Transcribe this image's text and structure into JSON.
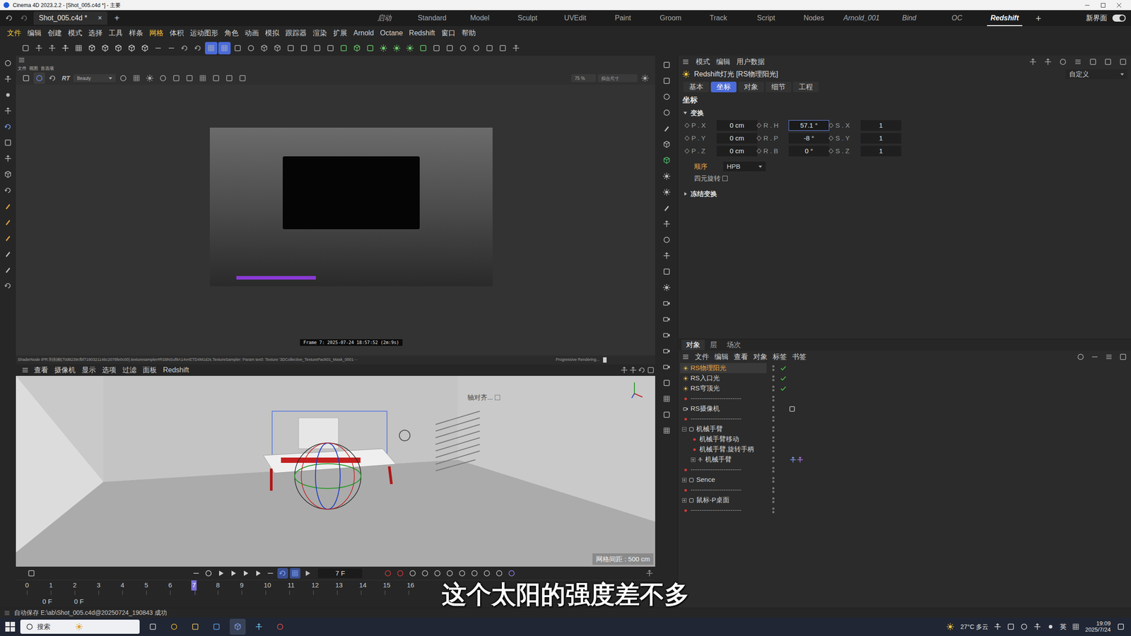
{
  "window": {
    "title": "Cinema 4D 2023.2.2 - [Shot_005.c4d *] - 主要"
  },
  "document_tab": {
    "label": "Shot_005.c4d *",
    "close": "×",
    "add": "+"
  },
  "layouts": [
    {
      "label": "启动",
      "selected": false,
      "italic": true
    },
    {
      "label": "Standard",
      "selected": false,
      "italic": false
    },
    {
      "label": "Model",
      "selected": false,
      "italic": false
    },
    {
      "label": "Sculpt",
      "selected": false,
      "italic": false
    },
    {
      "label": "UVEdit",
      "selected": false,
      "italic": false
    },
    {
      "label": "Paint",
      "selected": false,
      "italic": false
    },
    {
      "label": "Groom",
      "selected": false,
      "italic": false
    },
    {
      "label": "Track",
      "selected": false,
      "italic": false
    },
    {
      "label": "Script",
      "selected": false,
      "italic": false
    },
    {
      "label": "Nodes",
      "selected": false,
      "italic": false
    },
    {
      "label": "Arnold_001",
      "selected": false,
      "italic": true
    },
    {
      "label": "Bind",
      "selected": false,
      "italic": true
    },
    {
      "label": "OC",
      "selected": false,
      "italic": true
    },
    {
      "label": "Redshift",
      "selected": true,
      "italic": true
    }
  ],
  "layout_add": "+",
  "new_ui": {
    "label": "新界面",
    "on": true
  },
  "menu": [
    {
      "label": "文件",
      "highlight": true
    },
    {
      "label": "编辑",
      "highlight": false
    },
    {
      "label": "创建",
      "highlight": false
    },
    {
      "label": "模式",
      "highlight": false
    },
    {
      "label": "选择",
      "highlight": false
    },
    {
      "label": "工具",
      "highlight": false
    },
    {
      "label": "样条",
      "highlight": false
    },
    {
      "label": "网格",
      "highlight": true
    },
    {
      "label": "体积",
      "highlight": false
    },
    {
      "label": "运动图形",
      "highlight": false
    },
    {
      "label": "角色",
      "highlight": false
    },
    {
      "label": "动画",
      "highlight": false
    },
    {
      "label": "模拟",
      "highlight": false
    },
    {
      "label": "跟踪器",
      "highlight": false
    },
    {
      "label": "渲染",
      "highlight": false
    },
    {
      "label": "扩展",
      "highlight": false
    },
    {
      "label": "Arnold",
      "highlight": false
    },
    {
      "label": "Octane",
      "highlight": false
    },
    {
      "label": "Redshift",
      "highlight": false
    },
    {
      "label": "窗口",
      "highlight": false
    },
    {
      "label": "帮助",
      "highlight": false
    }
  ],
  "render_view": {
    "menu": [
      "文件",
      "视图",
      "首选项"
    ],
    "rt": "RT",
    "pass": "Beauty",
    "zoom": "75 %",
    "fit": "拟合尺寸",
    "caption": "Frame 7: 2025-07-24 18:57:52 (2m:9s)",
    "status_left": "ShaderNode IPR:到别称(70d8239cfbf7190321146c2078fe0c00).texturesampler#RS8NSuf8A14vnETD4M1dJs.TextureSampler: Param tex0: Texture '3DCollective_TexturePack01_Mask_0001···",
    "status_right": "Progressive Rendering..."
  },
  "viewport": {
    "menu": [
      "查看",
      "摄像机",
      "显示",
      "选项",
      "过滤",
      "面板",
      "Redshift"
    ],
    "axis_label": "轴对齐...",
    "grid": "网格间距 : 500 cm"
  },
  "timeline": {
    "frame": "7 F",
    "ticks": [
      {
        "label": "0",
        "selected": false
      },
      {
        "label": "1",
        "selected": false
      },
      {
        "label": "2",
        "selected": false
      },
      {
        "label": "3",
        "selected": false
      },
      {
        "label": "4",
        "selected": false
      },
      {
        "label": "5",
        "selected": false
      },
      {
        "label": "6",
        "selected": false
      },
      {
        "label": "7",
        "selected": true
      },
      {
        "label": "8",
        "selected": false
      },
      {
        "label": "9",
        "selected": false
      },
      {
        "label": "10",
        "selected": false
      },
      {
        "label": "11",
        "selected": false
      },
      {
        "label": "12",
        "selected": false
      },
      {
        "label": "13",
        "selected": false
      },
      {
        "label": "14",
        "selected": false
      },
      {
        "label": "15",
        "selected": false
      },
      {
        "label": "16",
        "selected": false
      }
    ],
    "start": "0 F",
    "end": "0 F"
  },
  "attributes": {
    "menu": [
      "模式",
      "编辑",
      "用户数据"
    ],
    "title": "Redshift灯光 [RS物理阳光]",
    "preset": "自定义",
    "tabs": [
      {
        "label": "基本",
        "selected": false
      },
      {
        "label": "坐标",
        "selected": true
      },
      {
        "label": "对象",
        "selected": false
      },
      {
        "label": "细节",
        "selected": false
      },
      {
        "label": "工程",
        "selected": false
      }
    ],
    "section": "坐标",
    "group": "变换",
    "fields": [
      [
        {
          "label": "P . X",
          "value": "0 cm",
          "focused": false
        },
        {
          "label": "R . H",
          "value": "57.1 °",
          "focused": true
        },
        {
          "label": "S . X",
          "value": "1",
          "focused": false
        }
      ],
      [
        {
          "label": "P . Y",
          "value": "0 cm",
          "focused": false
        },
        {
          "label": "R . P",
          "value": "-8 °",
          "focused": false
        },
        {
          "label": "S . Y",
          "value": "1",
          "focused": false
        }
      ],
      [
        {
          "label": "P . Z",
          "value": "0 cm",
          "focused": false
        },
        {
          "label": "R . B",
          "value": "0 °",
          "focused": false
        },
        {
          "label": "S . Z",
          "value": "1",
          "focused": false
        }
      ]
    ],
    "order_label": "顺序",
    "order_value": "HPB",
    "quat_label": "四元旋转",
    "quat_checked": false,
    "freeze": "冻结变换"
  },
  "objects": {
    "tabs": [
      {
        "label": "对象",
        "selected": true
      },
      {
        "label": "层",
        "selected": false
      },
      {
        "label": "场次",
        "selected": false
      }
    ],
    "menu": [
      "文件",
      "编辑",
      "查看",
      "对象",
      "标签",
      "书签"
    ],
    "items": [
      {
        "name": "RS物理阳光",
        "kind": "light",
        "depth": 0,
        "selected": true,
        "checked": true
      },
      {
        "name": "RS入口光",
        "kind": "light",
        "depth": 0,
        "selected": false,
        "checked": true
      },
      {
        "name": "RS穹顶光",
        "kind": "light",
        "depth": 0,
        "selected": false,
        "checked": true
      },
      {
        "name": "-----------------------",
        "kind": "separator",
        "depth": 0,
        "selected": false,
        "checked": false
      },
      {
        "name": "RS摄像机",
        "kind": "camera",
        "depth": 0,
        "selected": false,
        "checked": false
      },
      {
        "name": "-----------------------",
        "kind": "separator",
        "depth": 0,
        "selected": false,
        "checked": false
      },
      {
        "name": "机械手臂",
        "kind": "group",
        "depth": 0,
        "selected": false,
        "checked": false,
        "expanded": true
      },
      {
        "name": "机械手臂移动",
        "kind": "point",
        "depth": 1,
        "selected": false,
        "checked": false
      },
      {
        "name": "机械手臂.旋转手柄",
        "kind": "point",
        "depth": 1,
        "selected": false,
        "checked": false
      },
      {
        "name": "机械手臂",
        "kind": "joint",
        "depth": 1,
        "selected": false,
        "checked": false,
        "expanded": false
      },
      {
        "name": "-----------------------",
        "kind": "separator",
        "depth": 0,
        "selected": false,
        "checked": false
      },
      {
        "name": "Sence",
        "kind": "group",
        "depth": 0,
        "selected": false,
        "checked": false,
        "expanded": false
      },
      {
        "name": "-----------------------",
        "kind": "separator",
        "depth": 0,
        "selected": false,
        "checked": false
      },
      {
        "name": "鼠标-P桌面",
        "kind": "group",
        "depth": 0,
        "selected": false,
        "checked": false,
        "expanded": false
      },
      {
        "name": "-----------------------",
        "kind": "separator",
        "depth": 0,
        "selected": false,
        "checked": false
      }
    ]
  },
  "status_bar": "自动保存 E:\\ab\\Shot_005.c4d@20250724_190843 成功",
  "subtitle": "这个太阳的强度差不多",
  "taskbar": {
    "search": "搜索",
    "weather": "27°C 多云",
    "lang": "英",
    "time": "19:09",
    "date": "2025/7/24"
  }
}
